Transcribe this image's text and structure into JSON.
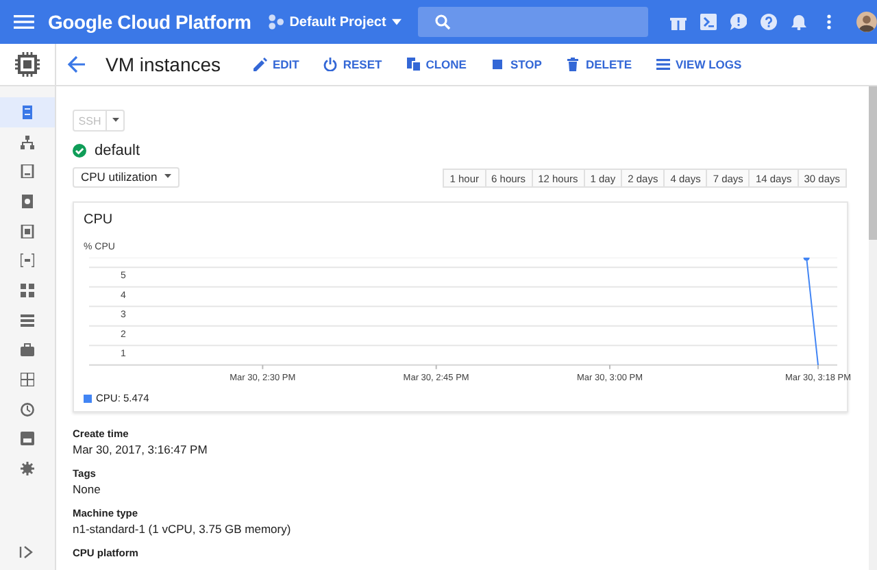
{
  "top_bar": {
    "title": "Google Cloud Platform",
    "project": "Default Project"
  },
  "sidebar": {
    "items": [
      {
        "selected": true
      },
      {
        "selected": false
      },
      {
        "selected": false
      },
      {
        "selected": false
      },
      {
        "selected": false
      },
      {
        "selected": false
      },
      {
        "selected": false
      },
      {
        "selected": false
      },
      {
        "selected": false
      },
      {
        "selected": false
      },
      {
        "selected": false
      },
      {
        "selected": false
      },
      {
        "selected": false
      }
    ]
  },
  "header": {
    "title": "VM instances",
    "actions": [
      "EDIT",
      "RESET",
      "CLONE",
      "STOP",
      "DELETE",
      "VIEW LOGS"
    ]
  },
  "ssh_button": {
    "label": "SSH",
    "disabled": true
  },
  "instance": {
    "name": "default",
    "running": true
  },
  "metric_dropdown": "CPU utilization",
  "time_ranges": [
    {
      "label": "1 hour",
      "selected": false
    },
    {
      "label": "6 hours",
      "selected": false
    },
    {
      "label": "12 hours",
      "selected": false
    },
    {
      "label": "1 day",
      "selected": false
    },
    {
      "label": "2 days",
      "selected": false
    },
    {
      "label": "4 days",
      "selected": false
    },
    {
      "label": "7 days",
      "selected": false
    },
    {
      "label": "14 days",
      "selected": false
    },
    {
      "label": "30 days",
      "selected": false
    }
  ],
  "chart": {
    "title": "CPU",
    "legend": "CPU: 5.474",
    "chart_data": {
      "type": "line",
      "ylabel": "% CPU",
      "categories": [
        null,
        null,
        null,
        null,
        null,
        null,
        null,
        null,
        null,
        null,
        null,
        null,
        null,
        null,
        null,
        "Mar 30, 2:30 PM",
        null,
        null,
        null,
        null,
        null,
        null,
        null,
        null,
        null,
        null,
        null,
        null,
        null,
        null,
        "Mar 30, 2:45 PM",
        null,
        null,
        null,
        null,
        null,
        null,
        null,
        null,
        null,
        null,
        null,
        null,
        null,
        null,
        "Mar 30, 3:00 PM",
        null,
        null,
        null,
        null,
        null,
        null,
        null,
        null,
        null,
        null,
        null,
        null,
        null,
        null,
        null,
        null,
        null,
        "Mar 30, 3:18 PM"
      ],
      "series": [
        {
          "color": "#4285f4",
          "values": [
            null,
            null,
            null,
            null,
            null,
            null,
            null,
            null,
            null,
            null,
            null,
            null,
            null,
            null,
            null,
            null,
            null,
            null,
            null,
            null,
            null,
            null,
            null,
            null,
            null,
            null,
            null,
            null,
            null,
            null,
            null,
            null,
            null,
            null,
            null,
            null,
            null,
            null,
            null,
            null,
            null,
            null,
            null,
            null,
            null,
            null,
            null,
            null,
            null,
            null,
            null,
            null,
            null,
            null,
            null,
            null,
            null,
            null,
            null,
            null,
            null,
            null,
            5.5,
            0
          ]
        }
      ],
      "grid": true,
      "ylim": [
        0,
        5.5
      ],
      "yticks": [
        1,
        2,
        3,
        4,
        5
      ]
    }
  },
  "details": [
    {
      "label": "Create time",
      "value": "Mar 30, 2017, 3:16:47 PM"
    },
    {
      "label": "Tags",
      "value": "None"
    },
    {
      "label": "Machine type",
      "value": "n1-standard-1 (1 vCPU, 3.75 GB memory)"
    },
    {
      "label": "CPU platform"
    }
  ]
}
